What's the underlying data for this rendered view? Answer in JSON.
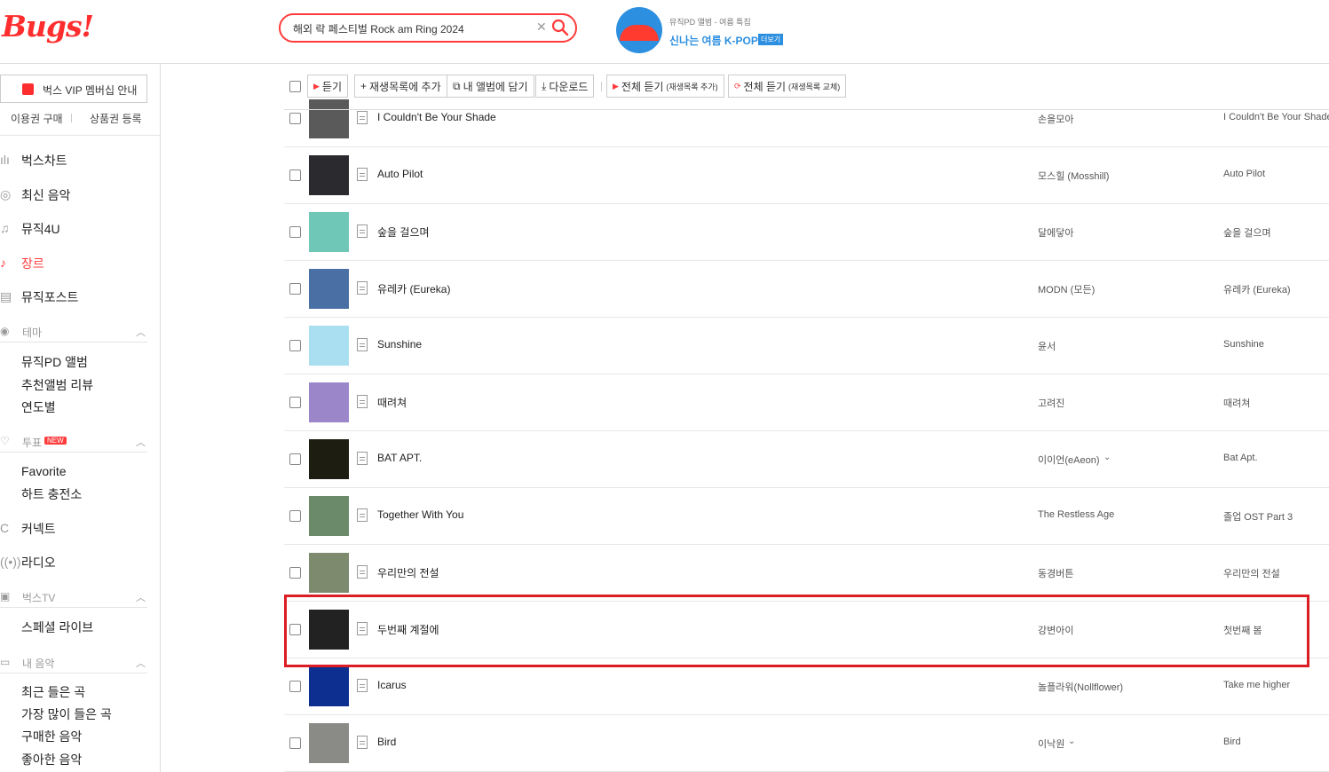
{
  "header": {
    "logo": "Bugs!",
    "search": {
      "value": "해외 락 페스티벌 Rock am Ring 2024"
    },
    "promo": {
      "subtitle": "뮤직PD 앨범 - 여름 특집",
      "title": "신나는 여름 K-POP",
      "more": "더보기"
    }
  },
  "sidebar": {
    "vip_label": "벅스 VIP 멤버십 안내",
    "sub_links": [
      "이용권 구매",
      "상품권 등록"
    ],
    "nav": [
      {
        "label": "벅스차트",
        "icon": "chart-icon"
      },
      {
        "label": "최신 음악",
        "icon": "new-music-icon"
      },
      {
        "label": "뮤직4U",
        "icon": "music-note-icon"
      },
      {
        "label": "장르",
        "icon": "guitar-icon",
        "active": true
      },
      {
        "label": "뮤직포스트",
        "icon": "post-icon"
      }
    ],
    "theme": {
      "label": "테마",
      "items": [
        "뮤직PD 앨범",
        "추천앨범 리뷰",
        "연도별"
      ]
    },
    "vote": {
      "label": "투표",
      "badge": "NEW",
      "items": [
        "Favorite",
        "하트 충전소"
      ]
    },
    "connect": "커넥트",
    "radio": "라디오",
    "bugs_tv": {
      "label": "벅스TV",
      "items": [
        "스페셜 라이브"
      ]
    },
    "my_music": {
      "label": "내 음악",
      "items": [
        "최근 들은 곡",
        "가장 많이 들은 곡",
        "구매한 음악",
        "좋아한 음악"
      ]
    }
  },
  "toolbar": {
    "listen": "듣기",
    "add_playlist": "재생목록에 추가",
    "add_album": "내 앨범에 담기",
    "download": "다운로드",
    "play_all_add": "전체 듣기",
    "play_all_add_note": "(재생목록 추가)",
    "play_all_replace": "전체 듣기",
    "play_all_replace_note": "(재생목록 교체)"
  },
  "tracks": [
    {
      "title": "I Couldn't Be Your Shade",
      "artist": "손을모아",
      "album": "I Couldn't Be Your Shade",
      "thumb_color": "#5a5a5a"
    },
    {
      "title": "Auto Pilot",
      "artist": "모스힐 (Mosshill)",
      "album": "Auto Pilot",
      "thumb_color": "#2b2a2f"
    },
    {
      "title": "숲을 걸으며",
      "artist": "달에닿아",
      "album": "숲을 걸으며",
      "thumb_color": "#6fc7b8"
    },
    {
      "title": "유레카 (Eureka)",
      "artist": "MODN (모든)",
      "album": "유레카 (Eureka)",
      "thumb_color": "#4a6fa5"
    },
    {
      "title": "Sunshine",
      "artist": "윤서",
      "album": "Sunshine",
      "thumb_color": "#a9dff0"
    },
    {
      "title": "때려쳐",
      "artist": "고려진",
      "album": "때려쳐",
      "thumb_color": "#9a86c9"
    },
    {
      "title": "BAT APT.",
      "artist": "이이언(eAeon)",
      "album": "Bat Apt.",
      "thumb_color": "#1d1d12",
      "artist_more": true
    },
    {
      "title": "Together With You",
      "artist": "The Restless Age",
      "album": "졸업 OST Part 3",
      "thumb_color": "#6b8a6a"
    },
    {
      "title": "우리만의 전설",
      "artist": "동경버튼",
      "album": "우리만의 전설",
      "thumb_color": "#7d8a6e"
    },
    {
      "title": "두번째 계절에",
      "artist": "강변아이",
      "album": "첫번째 봄",
      "thumb_color": "#222222"
    },
    {
      "title": "Icarus",
      "artist": "놀플라워(Nollflower)",
      "album": "Take me higher",
      "thumb_color": "#0d2f8f"
    },
    {
      "title": "Bird",
      "artist": "이낙원",
      "album": "Bird",
      "thumb_color": "#8a8a86",
      "artist_more": true
    }
  ],
  "colors": {
    "brand": "#ff3b3b",
    "highlight": "#dc1e24",
    "promo": "#2d8fe0"
  }
}
